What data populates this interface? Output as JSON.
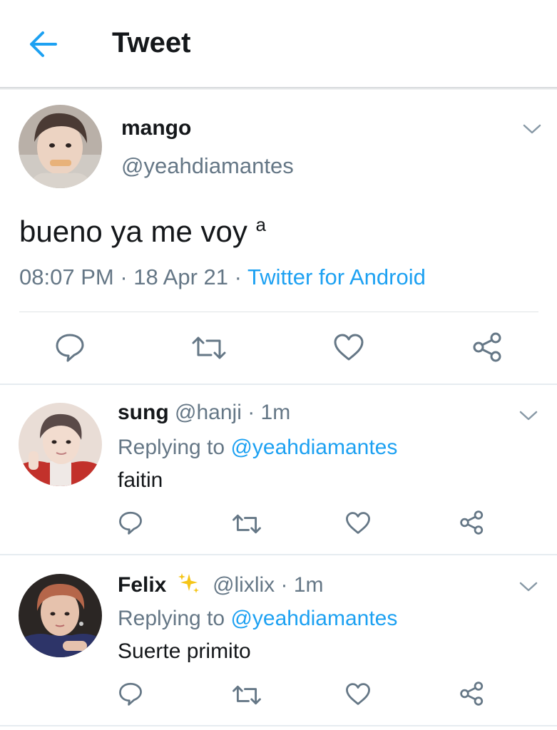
{
  "header": {
    "title": "Tweet"
  },
  "tweet": {
    "name": "mango",
    "handle": "@yeahdiamantes",
    "text": "bueno ya me voy",
    "superscript": "a",
    "time": "08:07 PM",
    "date": "18 Apr 21",
    "source": "Twitter for Android",
    "separator": "·"
  },
  "replies": [
    {
      "name": "sung",
      "handle": "@hanji",
      "time": "1m",
      "replying_label": "Replying to",
      "replying_to": "@yeahdiamantes",
      "text": "faitin"
    },
    {
      "name": "Felix",
      "handle": "@lixlix",
      "time": "1m",
      "replying_label": "Replying to",
      "replying_to": "@yeahdiamantes",
      "text": "Suerte primito"
    }
  ],
  "colors": {
    "accent": "#1da1f2",
    "secondary_text": "#657786",
    "primary_text": "#14171a"
  }
}
